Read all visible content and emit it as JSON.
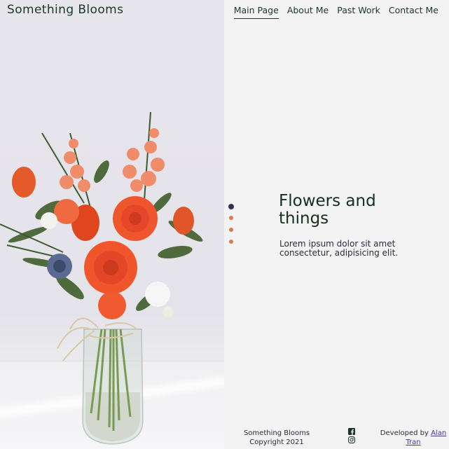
{
  "header": {
    "site_title": "Something Blooms",
    "nav": [
      {
        "label": "Main Page",
        "active": true
      },
      {
        "label": "About Me",
        "active": false
      },
      {
        "label": "Past Work",
        "active": false
      },
      {
        "label": "Contact Me",
        "active": false
      }
    ]
  },
  "hero": {
    "heading": "Flowers and things",
    "body": "Lorem ipsum dolor sit amet consectetur, adipisicing elit.",
    "image_icon": "flower-bouquet-photo"
  },
  "carousel": {
    "slide_count": 4,
    "active_index": 0
  },
  "footer": {
    "site_name": "Something Blooms",
    "copyright": "Copyright 2021",
    "social_icons": [
      "facebook-icon",
      "instagram-icon"
    ],
    "developed_by_prefix": "Developed by ",
    "developer_name": "Alan Tran"
  },
  "colors": {
    "text_dark_green": "#1d3526",
    "dot_active": "#313155",
    "dot_inactive": "#e07a4d",
    "link": "#4a3a9a",
    "background": "#f3f3f3"
  }
}
